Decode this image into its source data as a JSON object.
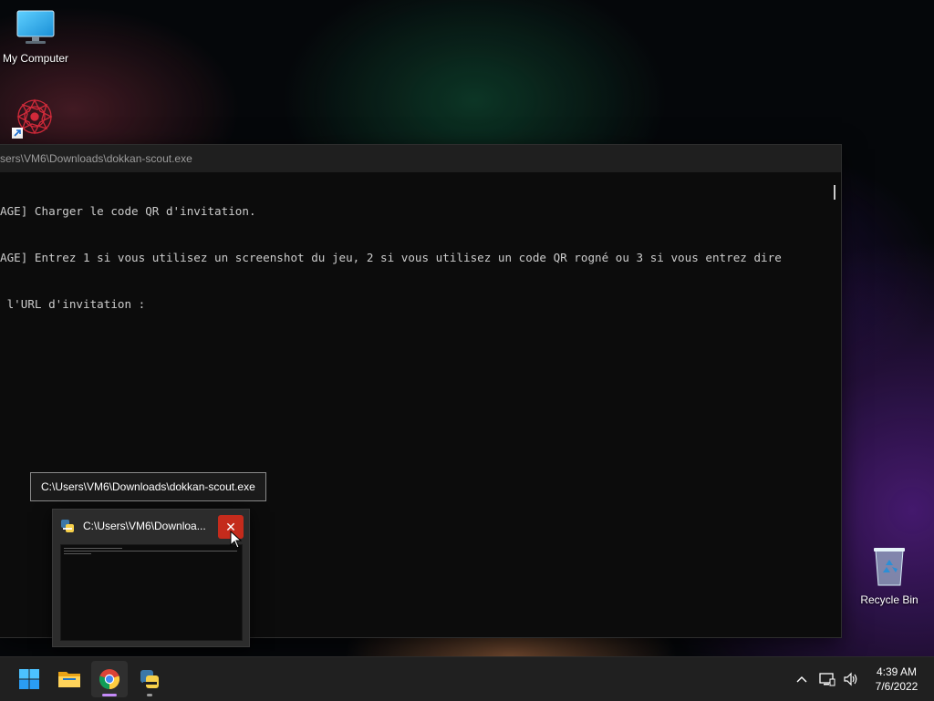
{
  "desktop": {
    "icons": [
      {
        "label": "My Computer"
      },
      {
        "label": ""
      },
      {
        "label": "Recycle Bin"
      }
    ]
  },
  "console": {
    "title": "sers\\VM6\\Downloads\\dokkan-scout.exe",
    "lines": [
      "AGE] Charger le code QR d'invitation.",
      "AGE] Entrez 1 si vous utilisez un screenshot du jeu, 2 si vous utilisez un code QR rogné ou 3 si vous entrez dire",
      " l'URL d'invitation :"
    ]
  },
  "tooltip": {
    "text": "C:\\Users\\VM6\\Downloads\\dokkan-scout.exe"
  },
  "thumbnail": {
    "title": "C:\\Users\\VM6\\Downloa..."
  },
  "taskbar": {
    "apps": [
      "start-icon",
      "file-explorer-icon",
      "chrome-icon",
      "python-icon"
    ],
    "clock": {
      "time": "4:39 AM",
      "date": "7/6/2022"
    }
  },
  "colors": {
    "close_red": "#c42b1c",
    "taskbar": "#202020",
    "console_bg": "#0c0c0c"
  }
}
